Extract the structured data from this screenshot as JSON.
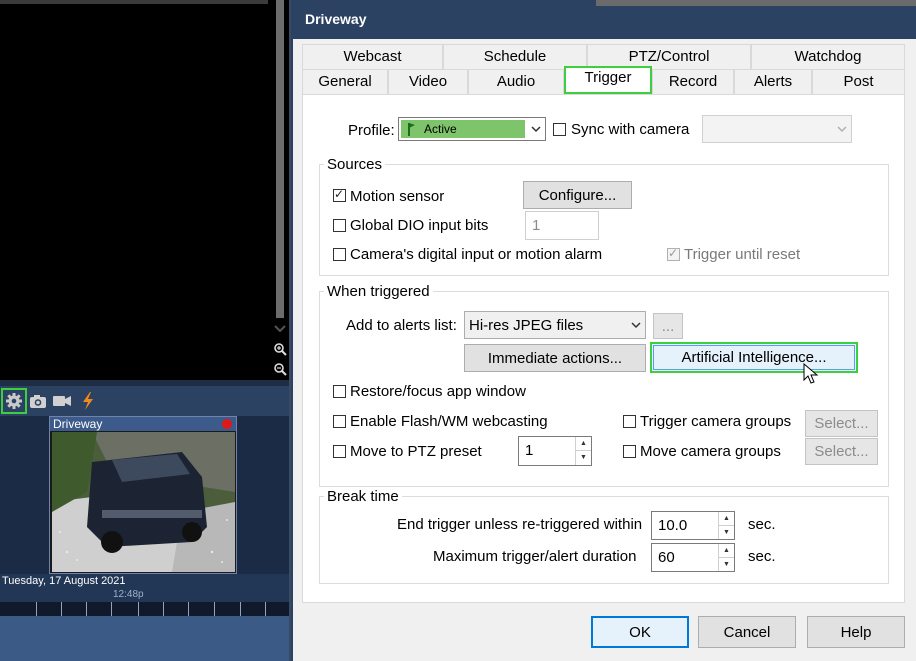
{
  "left_panel": {
    "camera_name": "Driveway",
    "date": "Tuesday, 17 August 2021",
    "time": "12:48p"
  },
  "dialog": {
    "title": "Driveway",
    "tabs_row1": [
      "Webcast",
      "Schedule",
      "PTZ/Control",
      "Watchdog"
    ],
    "tabs_row2": [
      "General",
      "Video",
      "Audio",
      "Trigger",
      "Record",
      "Alerts",
      "Post"
    ],
    "active_tab": "Trigger",
    "profile": {
      "label": "Profile:",
      "value": "Active",
      "color": "#7ec46b",
      "sync_label": "Sync with camera",
      "sync_checked": false
    },
    "sources": {
      "title": "Sources",
      "motion_sensor_label": "Motion sensor",
      "motion_sensor_checked": true,
      "configure_label": "Configure...",
      "global_dio_label": "Global DIO input bits",
      "global_dio_checked": false,
      "global_dio_value": "1",
      "camera_input_label": "Camera's digital input or motion alarm",
      "camera_input_checked": false,
      "trigger_until_reset_label": "Trigger until reset",
      "trigger_until_reset_checked": true
    },
    "when_triggered": {
      "title": "When triggered",
      "add_alerts_label": "Add to alerts list:",
      "add_alerts_value": "Hi-res JPEG files",
      "ellipsis_label": "...",
      "immediate_actions_label": "Immediate actions...",
      "ai_label": "Artificial Intelligence...",
      "restore_focus_label": "Restore/focus app window",
      "enable_flash_label": "Enable Flash/WM webcasting",
      "trigger_groups_label": "Trigger camera groups",
      "select1_label": "Select...",
      "move_ptz_label": "Move to PTZ preset",
      "ptz_value": "1",
      "move_groups_label": "Move camera groups",
      "select2_label": "Select..."
    },
    "break_time": {
      "title": "Break time",
      "end_trigger_label": "End trigger unless re-triggered within",
      "end_trigger_value": "10.0",
      "end_trigger_unit": "sec.",
      "max_duration_label": "Maximum trigger/alert duration",
      "max_duration_value": "60",
      "max_duration_unit": "sec."
    },
    "buttons": {
      "ok": "OK",
      "cancel": "Cancel",
      "help": "Help"
    }
  },
  "colors": {
    "accent_highlight": "#3ecf3e",
    "title_bar": "#2c4263",
    "focus_blue": "#0078d7"
  }
}
